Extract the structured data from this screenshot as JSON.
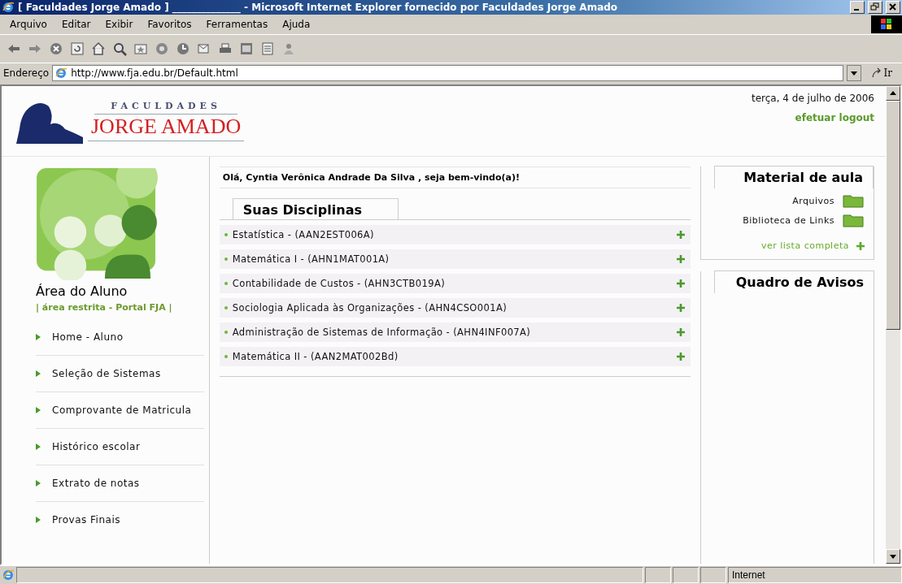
{
  "window": {
    "title": "[ Faculdades Jorge Amado ] ______________ - Microsoft Internet Explorer fornecido por Faculdades Jorge Amado"
  },
  "menu": [
    "Arquivo",
    "Editar",
    "Exibir",
    "Favoritos",
    "Ferramentas",
    "Ajuda"
  ],
  "address": {
    "label": "Endereço",
    "value": "http://www.fja.edu.br/Default.html",
    "go": "Ir"
  },
  "header": {
    "logo_top": "FACULDADES",
    "logo_main": "JORGE AMADO",
    "date": "terça, 4 de julho de 2006",
    "logout": "efetuar logout"
  },
  "sidebar": {
    "title": "Área do Aluno",
    "subtitle": "| área restrita - Portal FJA |",
    "items": [
      "Home - Aluno",
      "Seleção de Sistemas",
      "Comprovante de Matricula",
      "Histórico escolar",
      "Extrato de notas",
      "Provas Finais"
    ]
  },
  "greeting": "Olá, Cyntia Verônica Andrade Da Silva , seja bem-vindo(a)!",
  "courses": {
    "title": "Suas Disciplinas",
    "items": [
      {
        "name": "Estatística - (AAN2EST006A)"
      },
      {
        "name": "Matemática I - (AHN1MAT001A)"
      },
      {
        "name": "Contabilidade de Custos - (AHN3CTB019A)"
      },
      {
        "name": "Sociologia Aplicada às Organizações - (AHN4CSO001A)"
      },
      {
        "name": "Administração de Sistemas de Informação - (AHN4INF007A)"
      },
      {
        "name": "Matemática II - (AAN2MAT002Bd)"
      }
    ]
  },
  "material": {
    "title": "Material de aula",
    "items": [
      "Arquivos",
      "Biblioteca de Links"
    ],
    "more": "ver lista completa"
  },
  "notices": {
    "title": "Quadro de Avisos"
  },
  "status_bar": {
    "zone": "Internet"
  }
}
